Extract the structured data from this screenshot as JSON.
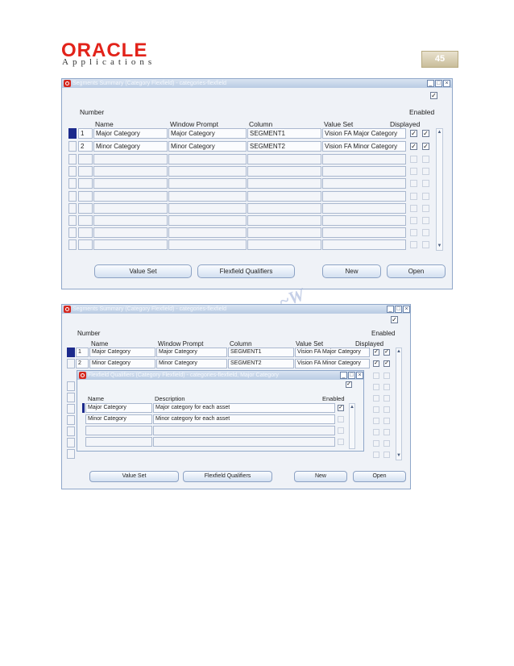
{
  "header": {
    "logo_brand": "ORACLE",
    "logo_sub": "Applications",
    "page_number": "45"
  },
  "watermark": "~W",
  "colors": {
    "oracle_red": "#e2231a",
    "title_bar_blue": "#b8cbe3",
    "window_bg": "#eff2f7",
    "row_indicator": "#1c2a8c"
  },
  "window1": {
    "title": "Segments Summary (Category Flexfield) - categories-flexfield",
    "labels": {
      "number": "Number",
      "name": "Name",
      "window_prompt": "Window Prompt",
      "column": "Column",
      "value_set": "Value Set",
      "enabled": "Enabled",
      "displayed": "Displayed"
    },
    "rows": [
      {
        "number": "1",
        "name": "Major Category",
        "window_prompt": "Major Category",
        "column": "SEGMENT1",
        "value_set": "Vision FA Major Category",
        "displayed": true,
        "enabled": true
      },
      {
        "number": "2",
        "name": "Minor Category",
        "window_prompt": "Minor Category",
        "column": "SEGMENT2",
        "value_set": "Vision FA Minor Category",
        "displayed": true,
        "enabled": true
      }
    ],
    "buttons": {
      "value_set": "Value Set",
      "flexfield_qualifiers": "Flexfield Qualifiers",
      "new": "New",
      "open": "Open"
    }
  },
  "window2": {
    "title": "Segments Summary (Category Flexfield) - categories-flexfield",
    "labels": {
      "number": "Number",
      "name": "Name",
      "window_prompt": "Window Prompt",
      "column": "Column",
      "value_set": "Value Set",
      "enabled": "Enabled",
      "displayed": "Displayed"
    },
    "rows": [
      {
        "number": "1",
        "name": "Major Category",
        "window_prompt": "Major Category",
        "column": "SEGMENT1",
        "value_set": "Vision FA Major Category",
        "displayed": true,
        "enabled": true
      },
      {
        "number": "2",
        "name": "Minor Category",
        "window_prompt": "Minor Category",
        "column": "SEGMENT2",
        "value_set": "Vision FA Minor Category",
        "displayed": true,
        "enabled": true
      }
    ],
    "buttons": {
      "value_set": "Value Set",
      "flexfield_qualifiers": "Flexfield Qualifiers",
      "new": "New",
      "open": "Open"
    }
  },
  "qualifiers_window": {
    "title": "Flexfield Qualifiers (Category Flexfield) - categories-flexfield, Major Category",
    "labels": {
      "name": "Name",
      "description": "Description",
      "enabled": "Enabled"
    },
    "rows": [
      {
        "name": "Major Category",
        "description": "Major category for each asset",
        "enabled": true
      },
      {
        "name": "Minor Category",
        "description": "Minor category for each asset",
        "enabled": false
      }
    ]
  }
}
